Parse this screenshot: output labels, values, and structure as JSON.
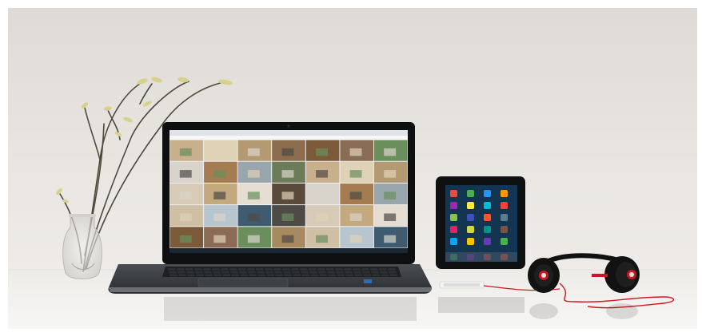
{
  "scene": {
    "subjects": [
      "plant-vase",
      "laptop",
      "tablet",
      "headphones"
    ]
  },
  "colors": {
    "wall": "#e6e2dd",
    "floor": "#f1efec",
    "laptop_body": "#35383c",
    "laptop_bezel": "#0e0f11",
    "keyboard": "#1d1f22",
    "tablet_body": "#0f1012",
    "headphones": "#121212",
    "headphones_accent": "#c61a22",
    "cable": "#d0171f",
    "plant": "#4b4a3c",
    "leaves": "#d9d08e"
  }
}
